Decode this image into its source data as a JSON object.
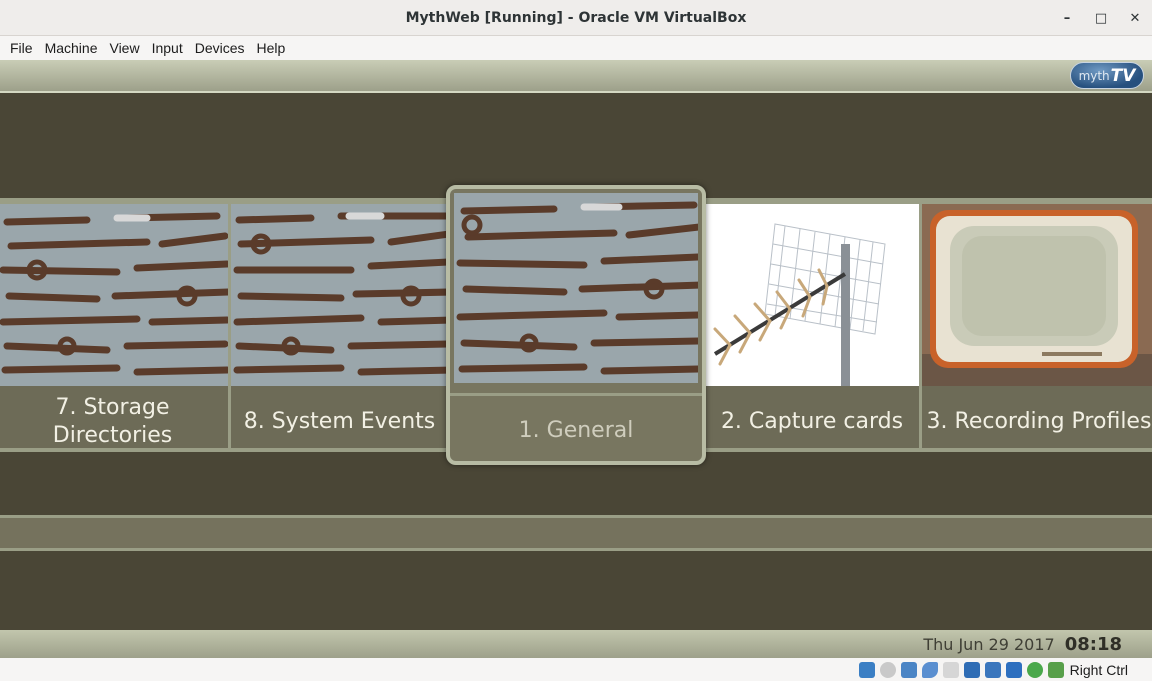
{
  "window": {
    "title": "MythWeb [Running] - Oracle VM VirtualBox",
    "controls": [
      "minimize",
      "maximize",
      "close"
    ]
  },
  "menubar": {
    "items": [
      "File",
      "Machine",
      "View",
      "Input",
      "Devices",
      "Help"
    ]
  },
  "mythtv": {
    "logo": {
      "prefix": "myth",
      "suffix": "TV"
    },
    "menu_items": [
      {
        "label": "7. Storage Directories",
        "image": "wrenches-icon"
      },
      {
        "label": "8. System Events",
        "image": "wrenches-icon"
      },
      {
        "label": "1. General",
        "image": "wrenches-icon",
        "focused": true
      },
      {
        "label": "2. Capture cards",
        "image": "antenna-icon"
      },
      {
        "label": "3. Recording Profiles",
        "image": "retro-tv-icon"
      }
    ],
    "date": "Thu Jun 29 2017",
    "time": "08:18"
  },
  "statusbar": {
    "icons": [
      "hard-disk-icon",
      "optical-drive-icon",
      "network-icon",
      "usb-icon",
      "shared-folder-icon",
      "display-icon",
      "video-capture-icon",
      "cpu-icon",
      "guest-additions-icon",
      "mouse-integration-icon"
    ],
    "host_key": "Right Ctrl"
  },
  "colors": {
    "screen_background": "#4a4636",
    "bar_background": "#9da08a",
    "label_text": "#f2f0e4",
    "logo_blue": "#26507e"
  }
}
